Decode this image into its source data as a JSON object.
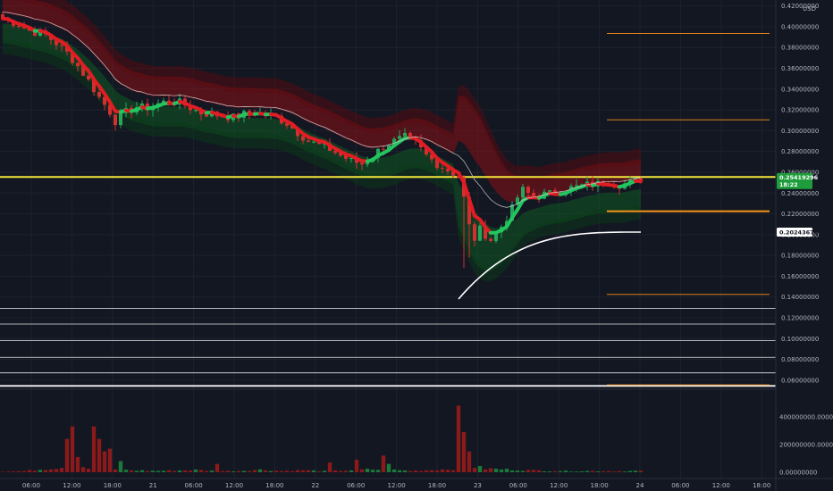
{
  "chart_data": {
    "type": "candlestick",
    "title": "",
    "currency": "USD",
    "price_axis": {
      "ticks": [
        "0.42000000",
        "0.40000000",
        "0.38000000",
        "0.36000000",
        "0.34000000",
        "0.32000000",
        "0.30000000",
        "0.28000000",
        "0.26000000",
        "0.24000000",
        "0.22000000",
        "0.20000000",
        "0.18000000",
        "0.16000000",
        "0.14000000",
        "0.12000000",
        "0.10000000",
        "0.08000000",
        "0.06000000"
      ],
      "range": [
        0.053,
        0.424
      ]
    },
    "volume_axis": {
      "ticks": [
        "400000000.00000000",
        "200000000.00000000",
        "0.00000000"
      ],
      "range": [
        0,
        540000000
      ]
    },
    "time_axis": {
      "labels": [
        "06:00",
        "12:00",
        "18:00",
        "21",
        "06:00",
        "12:00",
        "18:00",
        "22",
        "06:00",
        "12:00",
        "18:00",
        "23",
        "06:00",
        "12:00",
        "18:00",
        "24",
        "06:00",
        "12:00",
        "18:00"
      ]
    },
    "last_price": {
      "value": 0.25419296,
      "label": "0.25419296",
      "countdown": "18:22",
      "color": "#26a69a"
    },
    "vwap_label": {
      "value": 0.20243679,
      "label": "0.20243679"
    },
    "key_level": {
      "value": 0.2555,
      "color": "#f5e63c"
    },
    "horizontal_lines_white": [
      0.129,
      0.114,
      0.098,
      0.082,
      0.067,
      0.0545
    ],
    "orange_levels": [
      0.3935,
      0.3105,
      0.2225,
      0.1425,
      0.0555
    ],
    "price_anchors": [
      [
        0,
        0.408
      ],
      [
        3,
        0.402
      ],
      [
        5,
        0.396
      ],
      [
        8,
        0.392
      ],
      [
        10,
        0.384
      ],
      [
        12,
        0.375
      ],
      [
        14,
        0.362
      ],
      [
        16,
        0.348
      ],
      [
        18,
        0.332
      ],
      [
        20,
        0.318
      ],
      [
        21,
        0.309
      ],
      [
        23,
        0.318
      ],
      [
        25,
        0.323
      ],
      [
        27,
        0.322
      ],
      [
        29,
        0.326
      ],
      [
        31,
        0.329
      ],
      [
        33,
        0.327
      ],
      [
        35,
        0.322
      ],
      [
        37,
        0.317
      ],
      [
        39,
        0.316
      ],
      [
        41,
        0.314
      ],
      [
        43,
        0.313
      ],
      [
        45,
        0.316
      ],
      [
        47,
        0.318
      ],
      [
        49,
        0.315
      ],
      [
        51,
        0.313
      ],
      [
        53,
        0.307
      ],
      [
        55,
        0.298
      ],
      [
        57,
        0.29
      ],
      [
        59,
        0.286
      ],
      [
        61,
        0.282
      ],
      [
        63,
        0.276
      ],
      [
        65,
        0.271
      ],
      [
        67,
        0.268
      ],
      [
        69,
        0.276
      ],
      [
        71,
        0.285
      ],
      [
        73,
        0.29
      ],
      [
        75,
        0.294
      ],
      [
        77,
        0.288
      ],
      [
        79,
        0.276
      ],
      [
        81,
        0.268
      ],
      [
        83,
        0.262
      ],
      [
        85,
        0.256
      ],
      [
        86,
        0.235
      ],
      [
        87,
        0.208
      ],
      [
        88,
        0.196
      ],
      [
        89,
        0.205
      ],
      [
        90,
        0.2
      ],
      [
        91,
        0.195
      ],
      [
        93,
        0.208
      ],
      [
        95,
        0.225
      ],
      [
        96,
        0.236
      ],
      [
        97,
        0.243
      ],
      [
        99,
        0.236
      ],
      [
        101,
        0.239
      ],
      [
        103,
        0.24
      ],
      [
        105,
        0.244
      ],
      [
        107,
        0.246
      ],
      [
        109,
        0.248
      ],
      [
        111,
        0.249
      ],
      [
        113,
        0.251
      ],
      [
        115,
        0.248
      ],
      [
        117,
        0.25
      ],
      [
        119,
        0.254
      ]
    ],
    "volume_anchors": [
      [
        0,
        5
      ],
      [
        4,
        8
      ],
      [
        8,
        24
      ],
      [
        12,
        40
      ],
      [
        13,
        60
      ],
      [
        16,
        30
      ],
      [
        17,
        90
      ],
      [
        18,
        50
      ],
      [
        19,
        20
      ],
      [
        24,
        14
      ],
      [
        28,
        10
      ],
      [
        32,
        12
      ],
      [
        36,
        16
      ],
      [
        40,
        8
      ],
      [
        44,
        10
      ],
      [
        48,
        18
      ],
      [
        52,
        9
      ],
      [
        56,
        14
      ],
      [
        60,
        8
      ],
      [
        64,
        12
      ],
      [
        68,
        20
      ],
      [
        72,
        18
      ],
      [
        76,
        10
      ],
      [
        80,
        16
      ],
      [
        84,
        24
      ],
      [
        85,
        140
      ],
      [
        86,
        90
      ],
      [
        87,
        60
      ],
      [
        88,
        40
      ],
      [
        90,
        26
      ],
      [
        94,
        20
      ],
      [
        98,
        14
      ],
      [
        102,
        10
      ],
      [
        106,
        8
      ],
      [
        110,
        9
      ],
      [
        114,
        8
      ],
      [
        119,
        10
      ]
    ],
    "volume_spikes": {
      "12": 240,
      "13": 330,
      "14": 110,
      "17": 330,
      "18": 240,
      "19": 150,
      "20": 170,
      "85": 480,
      "86": 290,
      "87": 150,
      "71": 120,
      "22": 80,
      "40": 60,
      "61": 70,
      "66": 90,
      "72": 60
    }
  }
}
